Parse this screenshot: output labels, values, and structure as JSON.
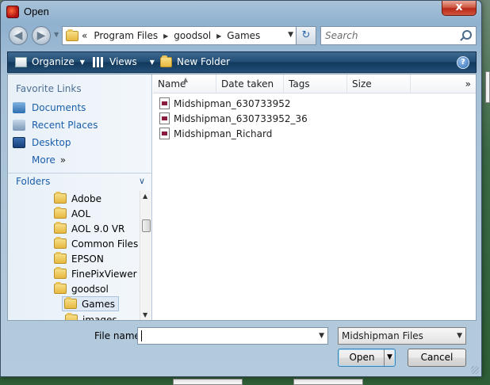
{
  "window": {
    "title": "Open",
    "close_label": "x"
  },
  "address": {
    "overflow": "«",
    "crumbs": [
      "Program Files",
      "goodsol",
      "Games"
    ],
    "search_placeholder": "Search"
  },
  "toolbar": {
    "organize": "Organize",
    "views": "Views",
    "new_folder": "New Folder",
    "help": "?"
  },
  "nav": {
    "favorites_header": "Favorite Links",
    "favorites": [
      "Documents",
      "Recent Places",
      "Desktop",
      "More"
    ],
    "more_chevron": "»",
    "folders_header": "Folders",
    "tree": [
      "Adobe",
      "AOL",
      "AOL 9.0 VR",
      "Common Files",
      "EPSON",
      "FinePixViewer",
      "goodsol",
      "Games",
      "images"
    ]
  },
  "columns": {
    "name": "Name",
    "date_taken": "Date taken",
    "tags": "Tags",
    "size": "Size",
    "more": "»"
  },
  "files": [
    "Midshipman_630733952",
    "Midshipman_630733952_36",
    "Midshipman_Richard"
  ],
  "bottom": {
    "file_name_label": "File name:",
    "file_name_value": "",
    "file_type": "Midshipman Files",
    "open": "Open",
    "cancel": "Cancel"
  }
}
